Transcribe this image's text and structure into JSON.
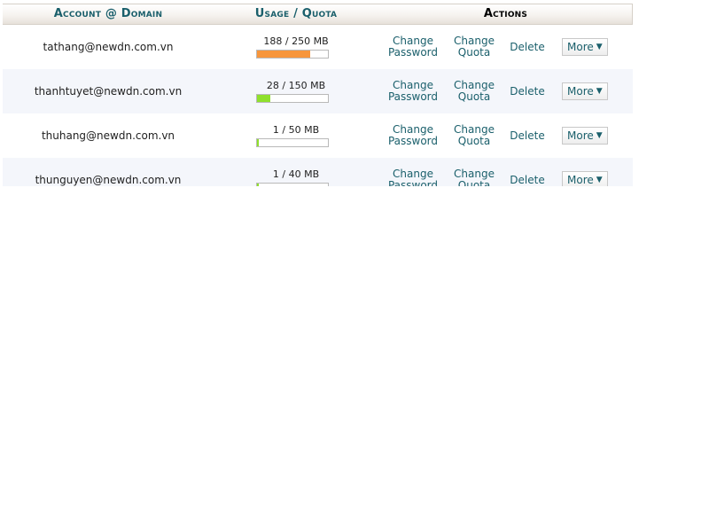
{
  "header": {
    "account_label": "Account @ Domain",
    "usage_label": "Usage",
    "quota_label": "Quota",
    "separator": "/",
    "actions_label": "Actions"
  },
  "accounts": [
    {
      "email": "tathang@newdn.com.vn",
      "used": "188",
      "quota": "250",
      "unit": "MB",
      "percent": 75.2,
      "bar_color": "#f7963c",
      "change_password": [
        "Change",
        "Password"
      ],
      "change_quota": [
        "Change",
        "Quota"
      ],
      "delete_label": "Delete",
      "more_label": "More"
    },
    {
      "email": "thanhtuyet@newdn.com.vn",
      "used": "28",
      "quota": "150",
      "unit": "MB",
      "percent": 18.7,
      "bar_color": "#8fe02c",
      "change_password": [
        "Change",
        "Password"
      ],
      "change_quota": [
        "Change",
        "Quota"
      ],
      "delete_label": "Delete",
      "more_label": "More"
    },
    {
      "email": "thuhang@newdn.com.vn",
      "used": "1",
      "quota": "50",
      "unit": "MB",
      "percent": 2,
      "bar_color": "#8fe02c",
      "change_password": [
        "Change",
        "Password"
      ],
      "change_quota": [
        "Change",
        "Quota"
      ],
      "delete_label": "Delete",
      "more_label": "More"
    },
    {
      "email": "thunguyen@newdn.com.vn",
      "used": "1",
      "quota": "40",
      "unit": "MB",
      "percent": 2.5,
      "bar_color": "#8fe02c",
      "change_password": [
        "Change",
        "Password"
      ],
      "change_quota": [
        "Change",
        "Quota"
      ],
      "delete_label": "Delete",
      "more_label": "More"
    }
  ],
  "icons": {
    "more_caret": "caret-down-icon"
  }
}
